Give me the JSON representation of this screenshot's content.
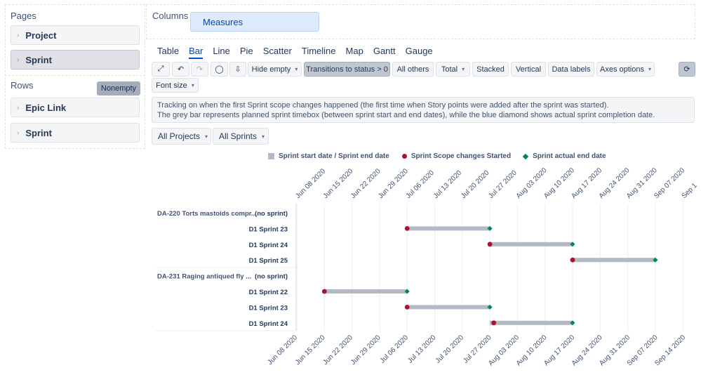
{
  "pages": {
    "title": "Pages",
    "items": [
      {
        "label": "Project",
        "selected": false
      },
      {
        "label": "Sprint",
        "selected": true
      }
    ]
  },
  "rows": {
    "title": "Rows",
    "nonempty_label": "Nonempty",
    "items": [
      {
        "label": "Epic Link"
      },
      {
        "label": "Sprint"
      }
    ]
  },
  "columns": {
    "title": "Columns",
    "measure_label": "Measures"
  },
  "chart_tabs": [
    {
      "label": "Table",
      "active": false
    },
    {
      "label": "Bar",
      "active": true
    },
    {
      "label": "Line",
      "active": false
    },
    {
      "label": "Pie",
      "active": false
    },
    {
      "label": "Scatter",
      "active": false
    },
    {
      "label": "Timeline",
      "active": false
    },
    {
      "label": "Map",
      "active": false
    },
    {
      "label": "Gantt",
      "active": false
    },
    {
      "label": "Gauge",
      "active": false
    }
  ],
  "toolbar": {
    "hide_empty": "Hide empty",
    "transitions": "Transitions to status > 0",
    "all_others": "All others",
    "total": "Total",
    "stacked": "Stacked",
    "vertical": "Vertical",
    "data_labels": "Data labels",
    "axes_options": "Axes options",
    "font_size": "Font size",
    "icons": [
      "expand-icon",
      "undo-icon",
      "redo-icon",
      "comment-icon",
      "download-icon",
      "refresh-icon"
    ]
  },
  "description": {
    "line1": "Tracking on when the first Sprint scope changes happened (the first time when Story points were added after the sprint was started).",
    "line2": "The grey bar represents planned sprint timebox (between sprint start and end dates), while the blue diamond shows actual sprint completion date."
  },
  "filters": {
    "projects": "All Projects",
    "sprints": "All Sprints"
  },
  "colors": {
    "bar": "#b3bac5",
    "scope_change": "#b0102e",
    "actual_end": "#00875a",
    "accent": "#0052cc"
  },
  "chart_data": {
    "type": "bar",
    "orientation": "horizontal",
    "legend": [
      "Sprint start date / Sprint end date",
      "Sprint Scope changes Started",
      "Sprint actual end date"
    ],
    "legend_position": "top",
    "grid": true,
    "top_axis": {
      "range": [
        "2020-06-08",
        "2020-09-14"
      ],
      "tick_labels": [
        "Jun 08 2020",
        "Jun 15 2020",
        "Jun 22 2020",
        "Jun 29 2020",
        "Jul 06 2020",
        "Jul 13 2020",
        "Jul 20 2020",
        "Jul 27 2020",
        "Aug 03 2020",
        "Aug 10 2020",
        "Aug 17 2020",
        "Aug 24 2020",
        "Aug 31 2020",
        "Sep 07 2020",
        "Sep 1"
      ]
    },
    "bottom_axis": {
      "range": [
        "2020-06-08",
        "2020-09-14"
      ],
      "tick_labels": [
        "Jun 08 2020",
        "Jun 15 2020",
        "Jun 22 2020",
        "Jun 29 2020",
        "Jul 06 2020",
        "Jul 13 2020",
        "Jul 20 2020",
        "Jul 27 2020",
        "Aug 03 2020",
        "Aug 10 2020",
        "Aug 17 2020",
        "Aug 24 2020",
        "Aug 31 2020",
        "Sep 07 2020",
        "Sep 14 2020"
      ]
    },
    "groups": [
      {
        "epic": "DA-220 Torts mastoids compr...",
        "rows": [
          {
            "sprint": "(no sprint)"
          },
          {
            "sprint": "D1 Sprint 23",
            "start": "2020-07-06",
            "end": "2020-07-27",
            "scope_change": "2020-07-06",
            "actual_end": "2020-07-27"
          },
          {
            "sprint": "D1 Sprint 24",
            "start": "2020-07-27",
            "end": "2020-08-17",
            "scope_change": "2020-07-27",
            "actual_end": "2020-08-17"
          },
          {
            "sprint": "D1 Sprint 25",
            "start": "2020-08-17",
            "end": "2020-09-07",
            "scope_change": "2020-08-17",
            "actual_end": "2020-09-07"
          }
        ]
      },
      {
        "epic": "DA-231 Raging antiqued fly ...",
        "rows": [
          {
            "sprint": "(no sprint)"
          },
          {
            "sprint": "D1 Sprint 22",
            "start": "2020-06-15",
            "end": "2020-07-06",
            "scope_change": "2020-06-15",
            "actual_end": "2020-07-06"
          },
          {
            "sprint": "D1 Sprint 23",
            "start": "2020-07-06",
            "end": "2020-07-27",
            "scope_change": "2020-07-06",
            "actual_end": "2020-07-27"
          },
          {
            "sprint": "D1 Sprint 24",
            "start": "2020-07-27",
            "end": "2020-08-17",
            "scope_change": "2020-07-28",
            "actual_end": "2020-08-17"
          }
        ]
      }
    ]
  }
}
